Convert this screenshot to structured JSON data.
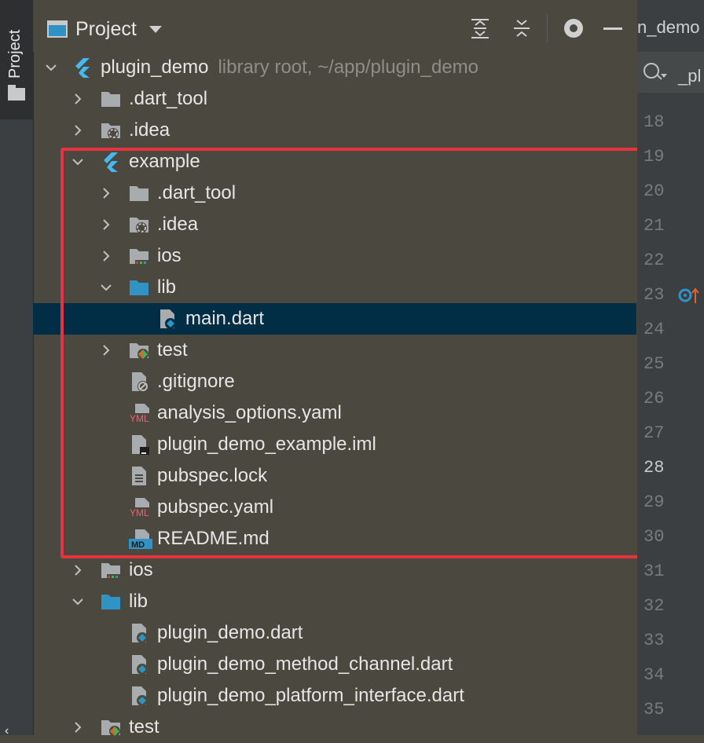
{
  "sidebar_tool_window": {
    "label": "Project",
    "bottom_glyph": "‹"
  },
  "panel_header": {
    "title": "Project",
    "actions": [
      "expand-all",
      "collapse-all",
      "settings",
      "hide"
    ]
  },
  "tree": {
    "root": {
      "name": "plugin_demo",
      "meta": "library root,  ~/app/plugin_demo"
    },
    "items": [
      {
        "label": ".dart_tool"
      },
      {
        "label": ".idea"
      },
      {
        "label": "example"
      },
      {
        "label": ".dart_tool"
      },
      {
        "label": ".idea"
      },
      {
        "label": "ios"
      },
      {
        "label": "lib"
      },
      {
        "label": "main.dart"
      },
      {
        "label": "test"
      },
      {
        "label": ".gitignore"
      },
      {
        "label": "analysis_options.yaml"
      },
      {
        "label": "plugin_demo_example.iml"
      },
      {
        "label": "pubspec.lock"
      },
      {
        "label": "pubspec.yaml"
      },
      {
        "label": "README.md"
      },
      {
        "label": "ios"
      },
      {
        "label": "lib"
      },
      {
        "label": "plugin_demo.dart"
      },
      {
        "label": "plugin_demo_method_channel.dart"
      },
      {
        "label": "plugin_demo_platform_interface.dart"
      },
      {
        "label": "test"
      }
    ],
    "badges": {
      "yml": "YML",
      "md": "MD"
    }
  },
  "editor": {
    "tab_label": "n_demo",
    "search_text": "_pl",
    "line_numbers": [
      "18",
      "19",
      "20",
      "21",
      "22",
      "23",
      "24",
      "25",
      "26",
      "27",
      "28",
      "29",
      "30",
      "31",
      "32",
      "33",
      "34",
      "35"
    ],
    "current_line": "28"
  },
  "colors": {
    "accent_selection": "#012e45",
    "highlight_box": "#e7333f",
    "folder": "#a8acaf",
    "source_folder": "#2f93c6",
    "flutter_blue": "#45b8f2"
  }
}
